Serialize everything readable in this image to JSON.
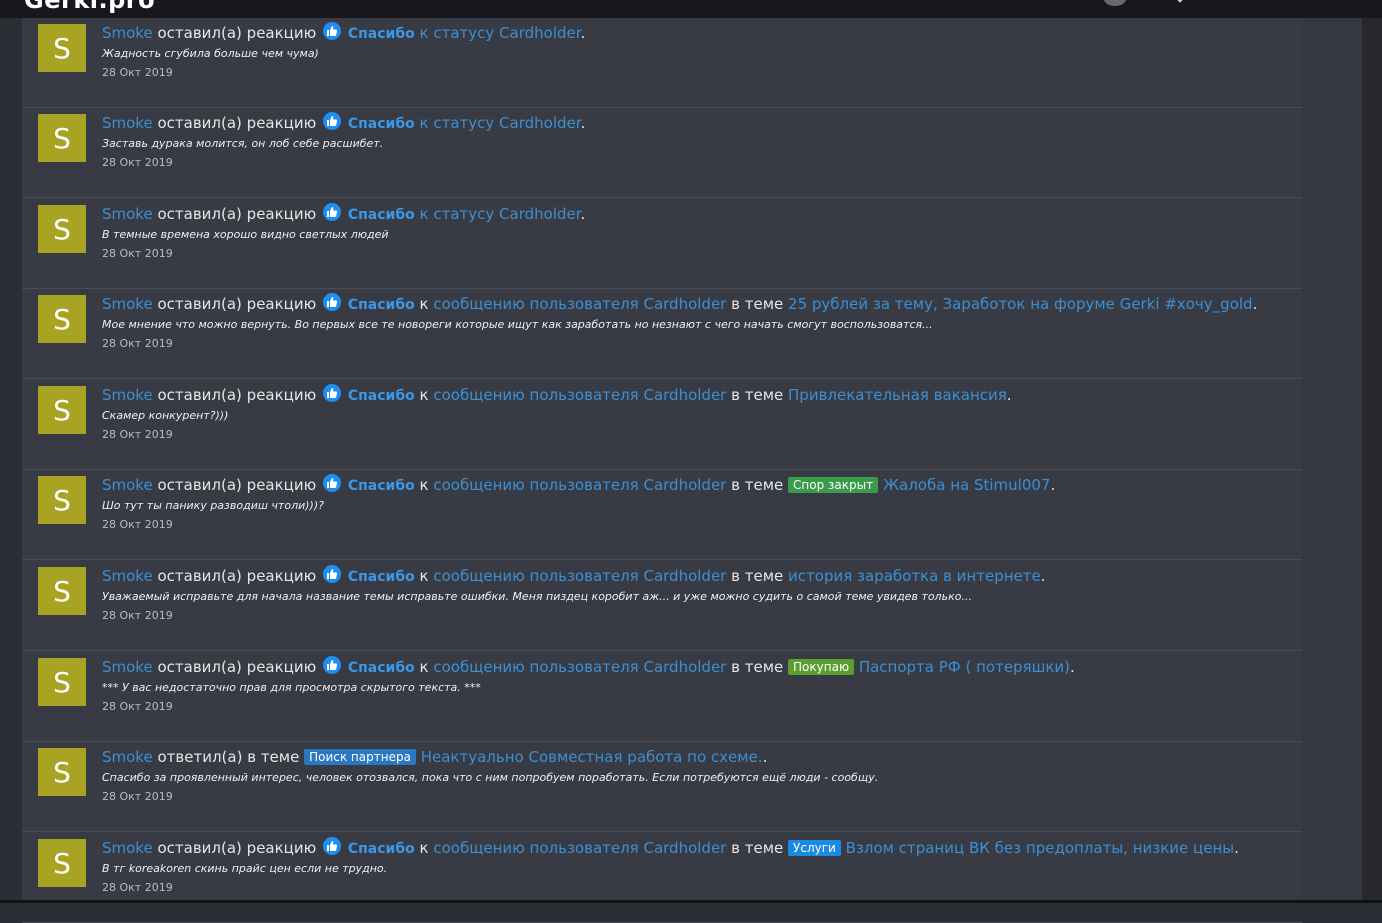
{
  "site": {
    "logo": "Gerki.pro"
  },
  "colors": {
    "page_bg": "#2b2e35",
    "feed_bg": "#383b43",
    "link": "#3c8fd4",
    "avatar_bg": "#a8a323",
    "like_icon": "#1f8ef1",
    "tag_green": "#3a9c4a",
    "tag_olive": "#5a9e2e",
    "tag_blue": "#2a78c2",
    "tag_cyan": "#1a8be0"
  },
  "items": [
    {
      "avatar": "S",
      "user": "Smoke",
      "action": "оставил(а) реакцию",
      "reaction": "Спасибо",
      "prep": "",
      "target": "к статусу Cardholder",
      "in_thread": "",
      "tag": "",
      "thread": "",
      "end": ".",
      "excerpt": "Жадность сгубила больше чем чума)",
      "date": "28 Окт 2019"
    },
    {
      "avatar": "S",
      "user": "Smoke",
      "action": "оставил(а) реакцию",
      "reaction": "Спасибо",
      "prep": "",
      "target": "к статусу Cardholder",
      "in_thread": "",
      "tag": "",
      "thread": "",
      "end": ".",
      "excerpt": "Заставь дурака молится, он лоб себе расшибет.",
      "date": "28 Окт 2019"
    },
    {
      "avatar": "S",
      "user": "Smoke",
      "action": "оставил(а) реакцию",
      "reaction": "Спасибо",
      "prep": "",
      "target": "к статусу Cardholder",
      "in_thread": "",
      "tag": "",
      "thread": "",
      "end": ".",
      "excerpt": "В темные времена хорошо видно светлых людей",
      "date": "28 Окт 2019"
    },
    {
      "avatar": "S",
      "user": "Smoke",
      "action": "оставил(а) реакцию",
      "reaction": "Спасибо",
      "prep": "к",
      "target": "сообщению пользователя Cardholder",
      "in_thread": "в теме",
      "tag": "",
      "thread": "25 рублей за тему, Заработок на форуме Gerki #хочу_gold",
      "end": ".",
      "excerpt": "Мое мнение что можно вернуть. Во первых все те новореги которые ищут как заработать но незнают с чего начать смогут воспользоватся...",
      "date": "28 Окт 2019"
    },
    {
      "avatar": "S",
      "user": "Smoke",
      "action": "оставил(а) реакцию",
      "reaction": "Спасибо",
      "prep": "к",
      "target": "сообщению пользователя Cardholder",
      "in_thread": "в теме",
      "tag": "",
      "thread": "Привлекательная вакансия",
      "end": ".",
      "excerpt": "Скамер конкурент?)))",
      "date": "28 Окт 2019"
    },
    {
      "avatar": "S",
      "user": "Smoke",
      "action": "оставил(а) реакцию",
      "reaction": "Спасибо",
      "prep": "к",
      "target": "сообщению пользователя Cardholder",
      "in_thread": "в теме",
      "tag": "Спор закрыт",
      "tag_color": "#3a9c4a",
      "thread": "Жалоба на Stimul007",
      "end": ".",
      "excerpt": "Шо тут ты панику разводиш чтоли)))?",
      "date": "28 Окт 2019"
    },
    {
      "avatar": "S",
      "user": "Smoke",
      "action": "оставил(а) реакцию",
      "reaction": "Спасибо",
      "prep": "к",
      "target": "сообщению пользователя Cardholder",
      "in_thread": "в теме",
      "tag": "",
      "thread": "история заработка в интернете",
      "end": ".",
      "excerpt": "Уважаемый исправьте для начала название темы исправьте ошибки. Меня пиздец коробит аж... и уже можно судить о самой теме увидев только...",
      "date": "28 Окт 2019"
    },
    {
      "avatar": "S",
      "user": "Smoke",
      "action": "оставил(а) реакцию",
      "reaction": "Спасибо",
      "prep": "к",
      "target": "сообщению пользователя Cardholder",
      "in_thread": "в теме",
      "tag": "Покупаю",
      "tag_color": "#5a9e2e",
      "thread": "Паспорта РФ ( потеряшки)",
      "end": ".",
      "excerpt": "*** У вас недостаточно прав для просмотра скрытого текста. ***",
      "date": "28 Окт 2019"
    },
    {
      "avatar": "S",
      "user": "Smoke",
      "action": "ответил(а) в теме",
      "reaction": "",
      "prep": "",
      "target": "",
      "in_thread": "",
      "tag": "Поиск партнера",
      "tag_color": "#2a78c2",
      "thread": "Неактуально Совместная работа по схеме.",
      "end": ".",
      "excerpt": "Спасибо за проявленный интерес, человек отозвался, пока что с ним попробуем поработать. Если потребуются ещё люди - сообщу.",
      "date": "28 Окт 2019"
    },
    {
      "avatar": "S",
      "user": "Smoke",
      "action": "оставил(а) реакцию",
      "reaction": "Спасибо",
      "prep": "к",
      "target": "сообщению пользователя Cardholder",
      "in_thread": "в теме",
      "tag": "Услуги",
      "tag_color": "#1a8be0",
      "thread": "Взлом страниц ВК без предоплаты, низкие цены",
      "end": ".",
      "excerpt": "В тг koreakoren скинь прайс цен если не трудно.",
      "date": "28 Окт 2019"
    }
  ]
}
